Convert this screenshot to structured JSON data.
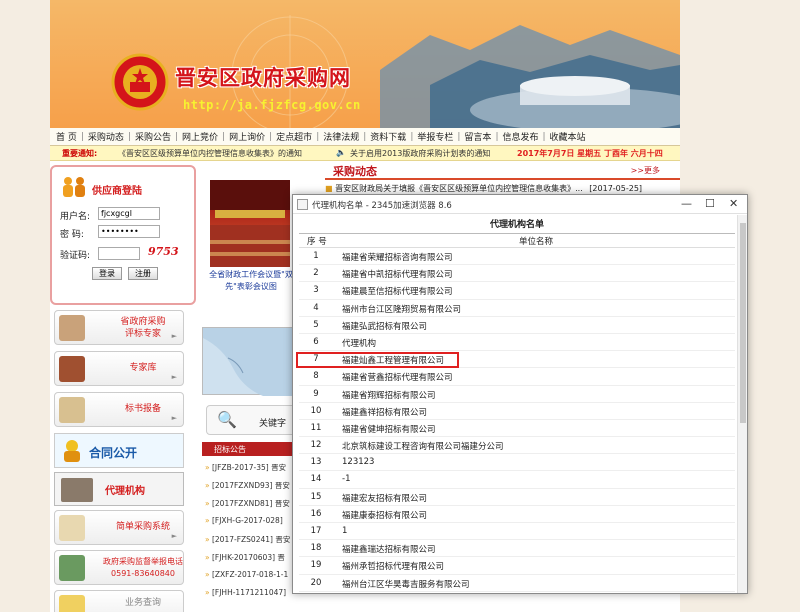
{
  "banner": {
    "title": "晋安区政府采购网",
    "url": "http://ja.fjzfcg.gov.cn"
  },
  "nav": [
    "首 页",
    "采购动态",
    "采购公告",
    "网上竞价",
    "网上询价",
    "定点超市",
    "法律法规",
    "资料下载",
    "举报专栏",
    "留言本",
    "信息发布",
    "收藏本站"
  ],
  "notice": {
    "label": "重要通知:",
    "text1": "《晋安区区级预算单位内控管理信息收集表》的通知",
    "speaker": "🔈",
    "text2": "关于启用2013版政府采购计划表的通知",
    "date": "2017年7月7日  星期五  丁酉年 六月十四"
  },
  "login": {
    "title": "供应商登陆",
    "user_label": "用户名:",
    "user_value": "fjcxgcgl",
    "pwd_label": "密  码:",
    "pwd_value": "••••••••",
    "code_label": "验证码:",
    "code_value": "",
    "captcha": "9753",
    "login_btn": "登录",
    "register_btn": "注册"
  },
  "side": {
    "b1": "省政府采购\n评标专家",
    "b2": "专家库",
    "b3": "标书报备",
    "hetong": "合同公开",
    "daili": "代理机构",
    "b6": "简单采购系统",
    "b7": "政府采购监督举报电话\n0591-83640840",
    "b8": "业务查询"
  },
  "dongtai": {
    "title": "采购动态",
    "more": ">>更多",
    "item": "晋安区财政局关于填报《晋安区区级预算单位内控管理信息收集表》...",
    "date": "[2017-05-25]"
  },
  "photo_caption": "全省财政工作会议暨\"双先\"表彰会议图",
  "search_label": "关键字",
  "bid": {
    "title": "招标公告",
    "items": [
      "[JFZB-2017-35] 晋安",
      "[2017FZXND93] 晋安",
      "[2017FZXND81] 晋安",
      "[FJXH-G-2017-028]",
      "[2017-FZS0241] 晋安",
      "[FJHK-20170603] 晋",
      "[ZXFZ-2017-018-1-1",
      "[FJHH-1171211047]"
    ]
  },
  "popup": {
    "window_title": "代理机构名单 - 2345加速浏览器 8.6",
    "table_title": "代理机构名单",
    "col_no": "序 号",
    "col_name": "单位名称",
    "rows": [
      {
        "no": "1",
        "name": "福建省荣耀招标咨询有限公司"
      },
      {
        "no": "2",
        "name": "福建省中凯招标代理有限公司"
      },
      {
        "no": "3",
        "name": "福建晨至信招标代理有限公司"
      },
      {
        "no": "4",
        "name": "福州市台江区隆翔贸易有限公司"
      },
      {
        "no": "5",
        "name": "福建弘武招标有限公司"
      },
      {
        "no": "6",
        "name": "代理机构"
      },
      {
        "no": "7",
        "name": "福建灿鑫工程管理有限公司"
      },
      {
        "no": "8",
        "name": "福建省营鑫招标代理有限公司"
      },
      {
        "no": "9",
        "name": "福建省翔辉招标有限公司"
      },
      {
        "no": "10",
        "name": "福建鑫祥招标有限公司"
      },
      {
        "no": "11",
        "name": "福建省健坤招标有限公司"
      },
      {
        "no": "12",
        "name": "北京筑标建设工程咨询有限公司福建分公司"
      },
      {
        "no": "13",
        "name": "123123"
      },
      {
        "no": "14",
        "name": "-1"
      },
      {
        "no": "15",
        "name": "福建宏友招标有限公司"
      },
      {
        "no": "16",
        "name": "福建康泰招标有限公司"
      },
      {
        "no": "17",
        "name": "1"
      },
      {
        "no": "18",
        "name": "福建鑫瑞达招标有限公司"
      },
      {
        "no": "19",
        "name": "福州承哲招标代理有限公司"
      },
      {
        "no": "20",
        "name": "福州台江区华昊毒吉服务有限公司"
      }
    ]
  },
  "colors": {
    "brand_red": "#d4141a",
    "highlight": "#e02020",
    "banner_orange": "#f08a32",
    "url_yellow": "#f7f230"
  }
}
